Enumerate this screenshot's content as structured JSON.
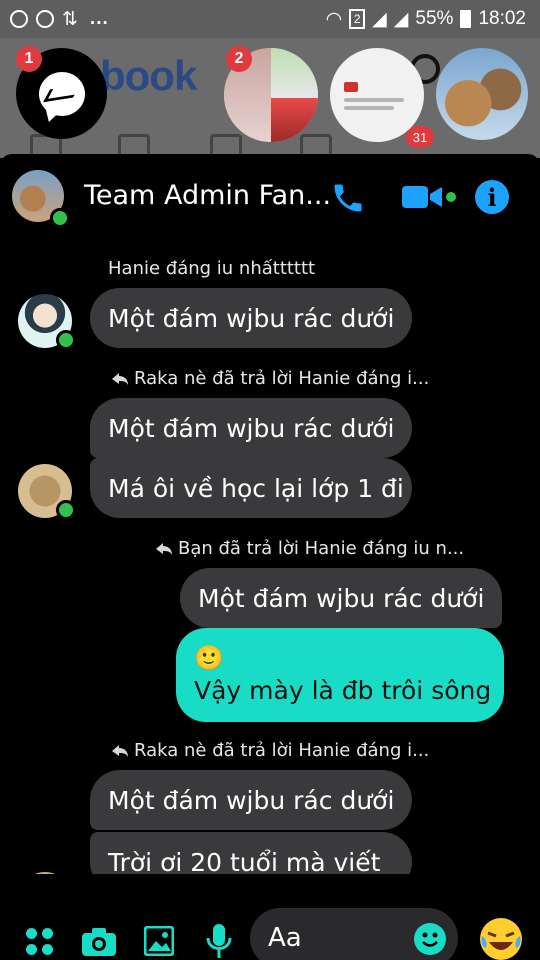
{
  "status_bar": {
    "dots": "...",
    "sim_slot": "2",
    "battery_percent": "55%",
    "time": "18:02"
  },
  "background": {
    "logo_text": "book",
    "badges": {
      "messenger": "1",
      "group": "2",
      "notifications": "31"
    }
  },
  "chat": {
    "title": "Team Admin Fan...",
    "messages": [
      {
        "meta": "Hanie đáng iu nhấtttttt",
        "bubbles": [
          "Một đám wjbu rác dưới"
        ]
      },
      {
        "meta": "Raka nè đã trả lời Hanie đáng i...",
        "bubbles": [
          "Một đám wjbu rác dưới",
          "Má ôi về học lại lớp 1 đi"
        ]
      },
      {
        "meta": "Bạn đã trả lời Hanie đáng iu n...",
        "bubbles": [
          "Một đám wjbu rác dưới"
        ],
        "reply_emoji": "🙂",
        "reply_text": "Vậy mày là đb trôi sông"
      },
      {
        "meta": "Raka nè đã trả lời Hanie đáng i...",
        "bubbles": [
          "Một đám wjbu rác dưới",
          "Trời ơi 20 tuổi mà viết"
        ]
      }
    ]
  },
  "composer": {
    "placeholder": "Aa"
  },
  "colors": {
    "accent": "#19dcc6",
    "messenger_blue": "#1ea2ff",
    "bubble_other": "#3a3a3c",
    "online": "#31c24d",
    "badge_red": "#e0393e"
  },
  "icons": [
    "apps-icon",
    "camera-icon",
    "image-icon",
    "mic-icon",
    "emoji-icon",
    "laughing-emoji-icon",
    "phone-icon",
    "video-camera-icon",
    "info-icon"
  ]
}
